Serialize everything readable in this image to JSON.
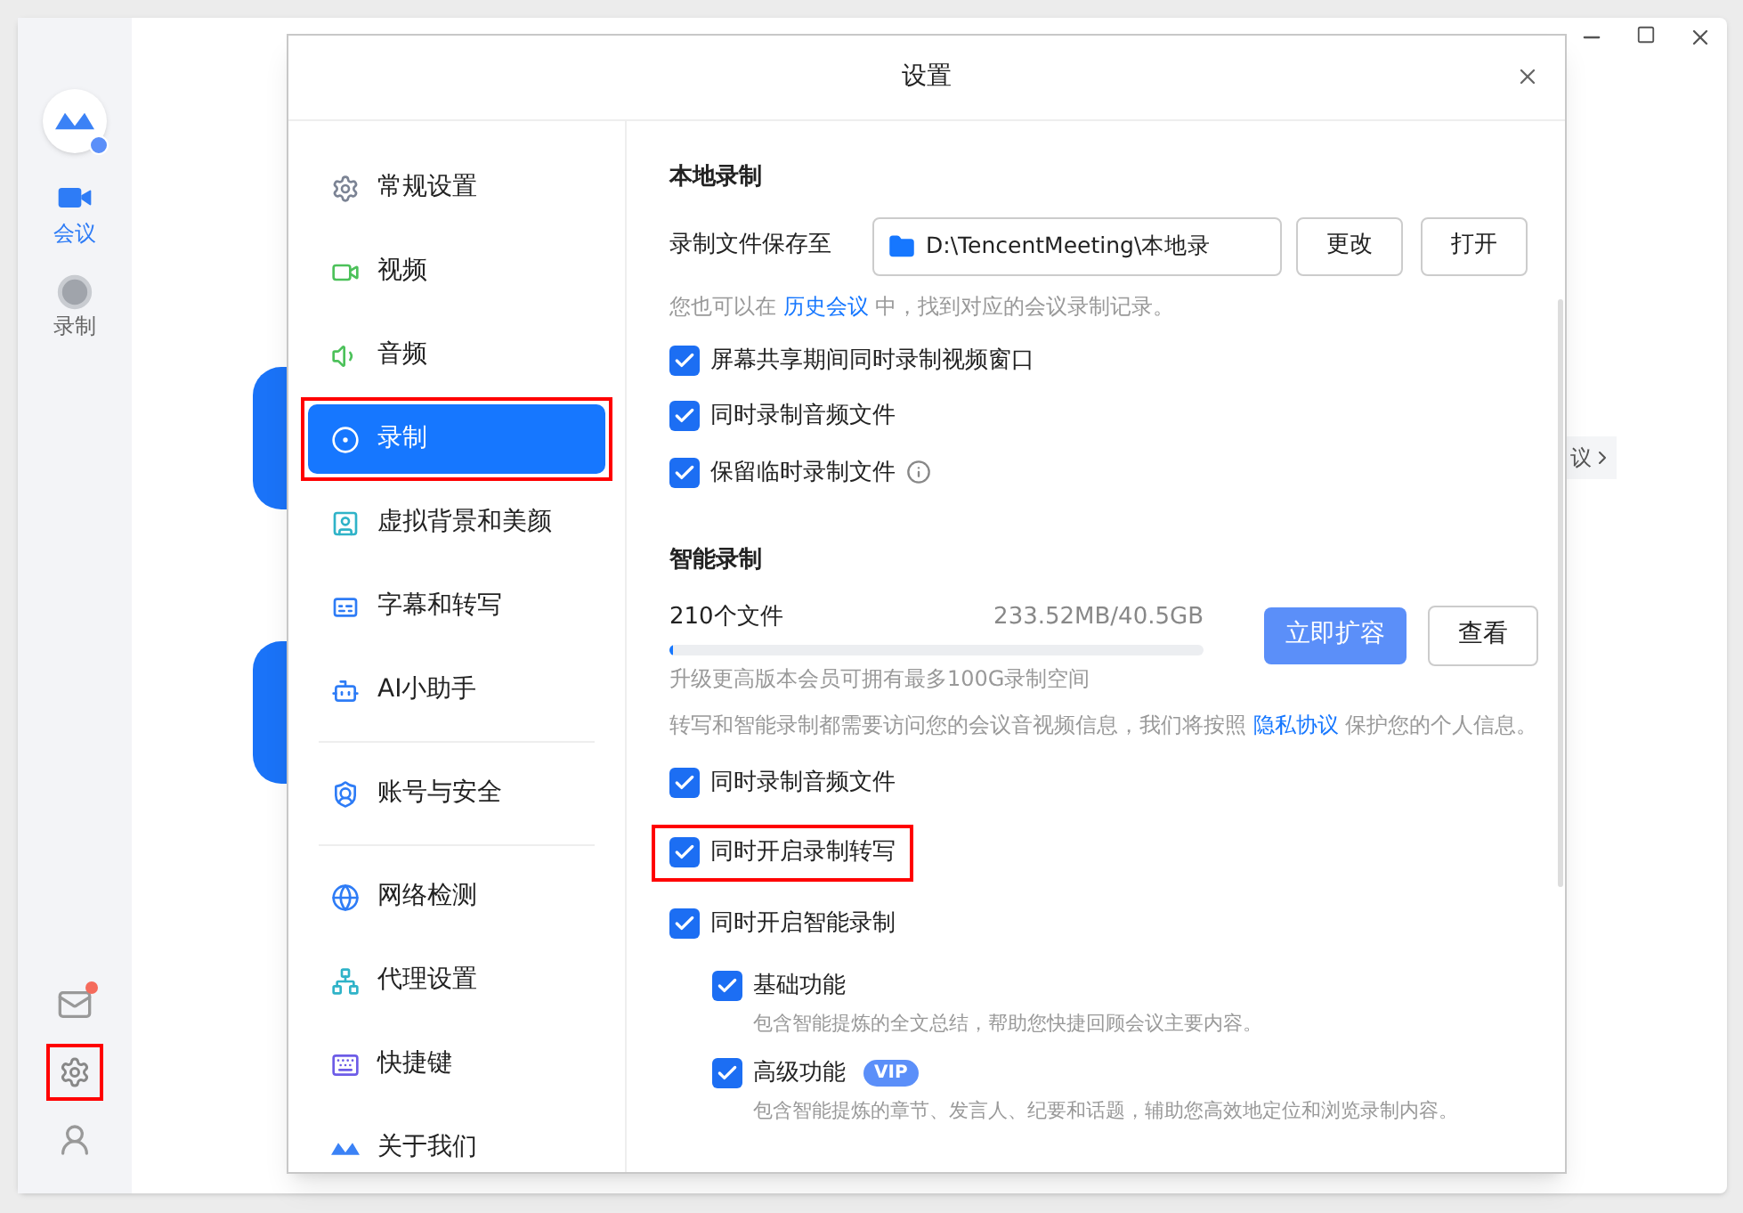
{
  "rail": {
    "items": [
      {
        "label": "会议",
        "selected": true
      },
      {
        "label": "录制",
        "selected": false
      }
    ],
    "mail_unread": true,
    "settings_highlighted": true
  },
  "background": {
    "link": "议"
  },
  "dialog": {
    "title": "设置",
    "nav": [
      {
        "label": "常规设置",
        "selected": false,
        "highlighted": false
      },
      {
        "label": "视频",
        "selected": false,
        "highlighted": false
      },
      {
        "label": "音频",
        "selected": false,
        "highlighted": false
      },
      {
        "label": "录制",
        "selected": true,
        "highlighted": true
      },
      {
        "label": "虚拟背景和美颜",
        "selected": false,
        "highlighted": false
      },
      {
        "label": "字幕和转写",
        "selected": false,
        "highlighted": false
      },
      {
        "label": "AI小助手",
        "selected": false,
        "highlighted": false,
        "divider_after": true
      },
      {
        "label": "账号与安全",
        "selected": false,
        "highlighted": false,
        "divider_after": true
      },
      {
        "label": "网络检测",
        "selected": false,
        "highlighted": false
      },
      {
        "label": "代理设置",
        "selected": false,
        "highlighted": false
      },
      {
        "label": "快捷键",
        "selected": false,
        "highlighted": false
      },
      {
        "label": "关于我们",
        "selected": false,
        "highlighted": false
      }
    ],
    "local": {
      "title": "本地录制",
      "path_label": "录制文件保存至",
      "path": "D:\\TencentMeeting\\本地录",
      "change_button": "更改",
      "open_button": "打开",
      "note": {
        "before": "您也可以在",
        "link": "历史会议",
        "after": "中，找到对应的会议录制记录。"
      },
      "options": [
        {
          "label": "屏幕共享期间同时录制视频窗口",
          "checked": true,
          "has_info": false
        },
        {
          "label": "同时录制音频文件",
          "checked": true,
          "has_info": false
        },
        {
          "label": "保留临时录制文件",
          "checked": true,
          "has_info": true
        }
      ]
    },
    "smart": {
      "title": "智能录制",
      "files": "210个文件",
      "usage": "233.52MB/40.5GB",
      "level": 0.006,
      "expand_button": "立即扩容",
      "view_button": "查看",
      "upgrade_note": "升级更高版本会员可拥有最多100G录制空间",
      "privacy": {
        "before": "转写和智能录制都需要访问您的会议音视频信息，我们将按照",
        "link": "隐私协议",
        "after": "保护您的个人信息。"
      },
      "options": [
        {
          "label": "同时录制音频文件",
          "checked": true,
          "highlighted": false
        },
        {
          "label": "同时开启录制转写",
          "checked": true,
          "highlighted": true
        },
        {
          "label": "同时开启智能录制",
          "checked": true,
          "highlighted": false
        }
      ],
      "sub_options": [
        {
          "label": "基础功能",
          "checked": true,
          "description": "包含智能提炼的全文总结，帮助您快捷回顾会议主要内容。"
        },
        {
          "label": "高级功能",
          "checked": true,
          "badge": "VIP",
          "description": "包含智能提炼的章节、发言人、纪要和话题，辅助您高效地定位和浏览录制内容。"
        }
      ]
    }
  }
}
